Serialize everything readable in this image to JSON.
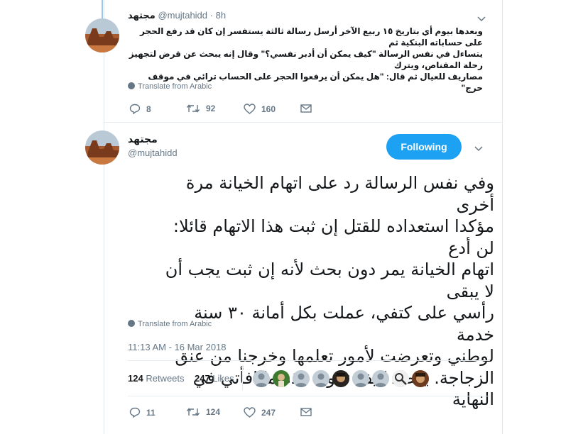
{
  "tweet1": {
    "display_name": "مجتهد",
    "handle": "@mujtahidd",
    "time": "· 8h",
    "text_lines": [
      "وبعدها بيوم أي بتاريخ ١٥ ربيع الآخر أرسل رسالة ثالثة يستفسر إن كان قد رفع الحجر على حساباته البنكية ثم",
      "يتساءل في نفس الرسالة \"كيف يمكن أن أدبر نفسي؟\" وقال إنه يبحث عن قرض لتجهيز رحلة المقناص، ويترك",
      "مصاريف للعيال ثم قال: \"هل يمكن أن يرفعوا الحجر على الحساب ترائي في موقف حرج\""
    ],
    "translate": "Translate from Arabic",
    "replies": "8",
    "retweets": "92",
    "likes": "160"
  },
  "tweet2": {
    "display_name": "مجتهد",
    "handle": "@mujtahidd",
    "follow_label": "Following",
    "text_lines": [
      "وفي نفس الرسالة رد على اتهام الخيانة مرة أخرى",
      "مؤكدا استعداده للقتل إن ثبت هذا الاتهام قائلا: لن أدع",
      "اتهام الخيانة يمر دون بحث لأنه إن ثبت يجب أن لا يبقى",
      "رأسي على كتفي، عملت بكل أمانة ٣٠ سنة خدمة",
      "لوطني وتعرضت لأمور تعلمها وخرجنا من عنق",
      "الزجاجة. يقصد كيف تكون هذه مكافأتي في النهاية"
    ],
    "translate": "Translate from Arabic",
    "timestamp": "11:13 AM - 16 Mar 2018",
    "retweets_count": "124",
    "retweets_label": "Retweets",
    "likes_count": "247",
    "likes_label": "Likes",
    "replies": "11",
    "retweets": "124",
    "likes": "247"
  },
  "colors": {
    "accent": "#1da1f2",
    "muted": "#657786",
    "text": "#14171a"
  }
}
